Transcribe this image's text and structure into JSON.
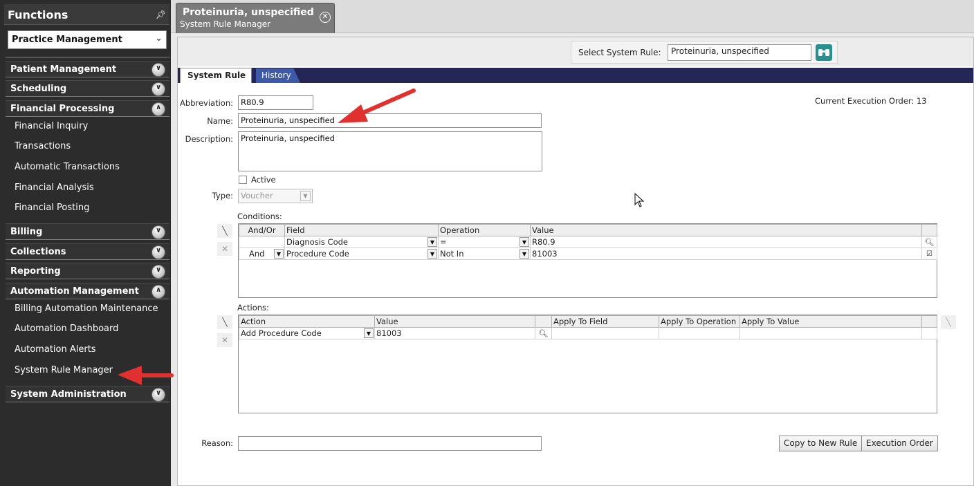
{
  "sidebar": {
    "title": "Functions",
    "module_select": "Practice Management",
    "sections": [
      {
        "label": "Patient Management",
        "state": "collapsed",
        "items": []
      },
      {
        "label": "Scheduling",
        "state": "collapsed",
        "items": []
      },
      {
        "label": "Financial Processing",
        "state": "expanded",
        "items": [
          "Financial Inquiry",
          "Transactions",
          "Automatic Transactions",
          "Financial Analysis",
          "Financial Posting"
        ]
      },
      {
        "label": "Billing",
        "state": "collapsed",
        "items": []
      },
      {
        "label": "Collections",
        "state": "collapsed",
        "items": []
      },
      {
        "label": "Reporting",
        "state": "collapsed",
        "items": []
      },
      {
        "label": "Automation Management",
        "state": "expanded",
        "items": [
          "Billing Automation Maintenance",
          "Automation Dashboard",
          "Automation Alerts",
          "System Rule Manager"
        ]
      },
      {
        "label": "System Administration",
        "state": "collapsed",
        "items": []
      }
    ]
  },
  "doc_tab": {
    "title": "Proteinuria, unspecified",
    "subtitle": "System Rule Manager"
  },
  "select_rule": {
    "label": "Select System Rule:",
    "value": "Proteinuria, unspecified"
  },
  "tabs": [
    "System Rule",
    "History"
  ],
  "form": {
    "abbreviation_label": "Abbreviation:",
    "abbreviation": "R80.9",
    "name_label": "Name:",
    "name": "Proteinuria, unspecified",
    "description_label": "Description:",
    "description": "Proteinuria, unspecified",
    "active_label": "Active",
    "type_label": "Type:",
    "type": "Voucher",
    "execution_order": "Current Execution Order: 13",
    "conditions_label": "Conditions:",
    "actions_label": "Actions:",
    "reason_label": "Reason:",
    "reason": ""
  },
  "conditions": {
    "headers": [
      "And/Or",
      "Field",
      "Operation",
      "Value"
    ],
    "rows": [
      {
        "andor": "",
        "field": "Diagnosis Code",
        "operation": "=",
        "value": "R80.9"
      },
      {
        "andor": "And",
        "field": "Procedure Code",
        "operation": "Not In",
        "value": "81003"
      }
    ]
  },
  "actions": {
    "headers": [
      "Action",
      "Value",
      "",
      "Apply To Field",
      "Apply To Operation",
      "Apply To Value"
    ],
    "rows": [
      {
        "action": "Add Procedure Code",
        "value": "81003"
      }
    ]
  },
  "buttons": {
    "copy": "Copy to New Rule",
    "exec": "Execution Order"
  },
  "colors": {
    "sidebar_bg": "#2c2c2c",
    "tab_strip": "#262656",
    "history_tab": "#3e5aa6",
    "annotation_arrow": "#e03030"
  }
}
